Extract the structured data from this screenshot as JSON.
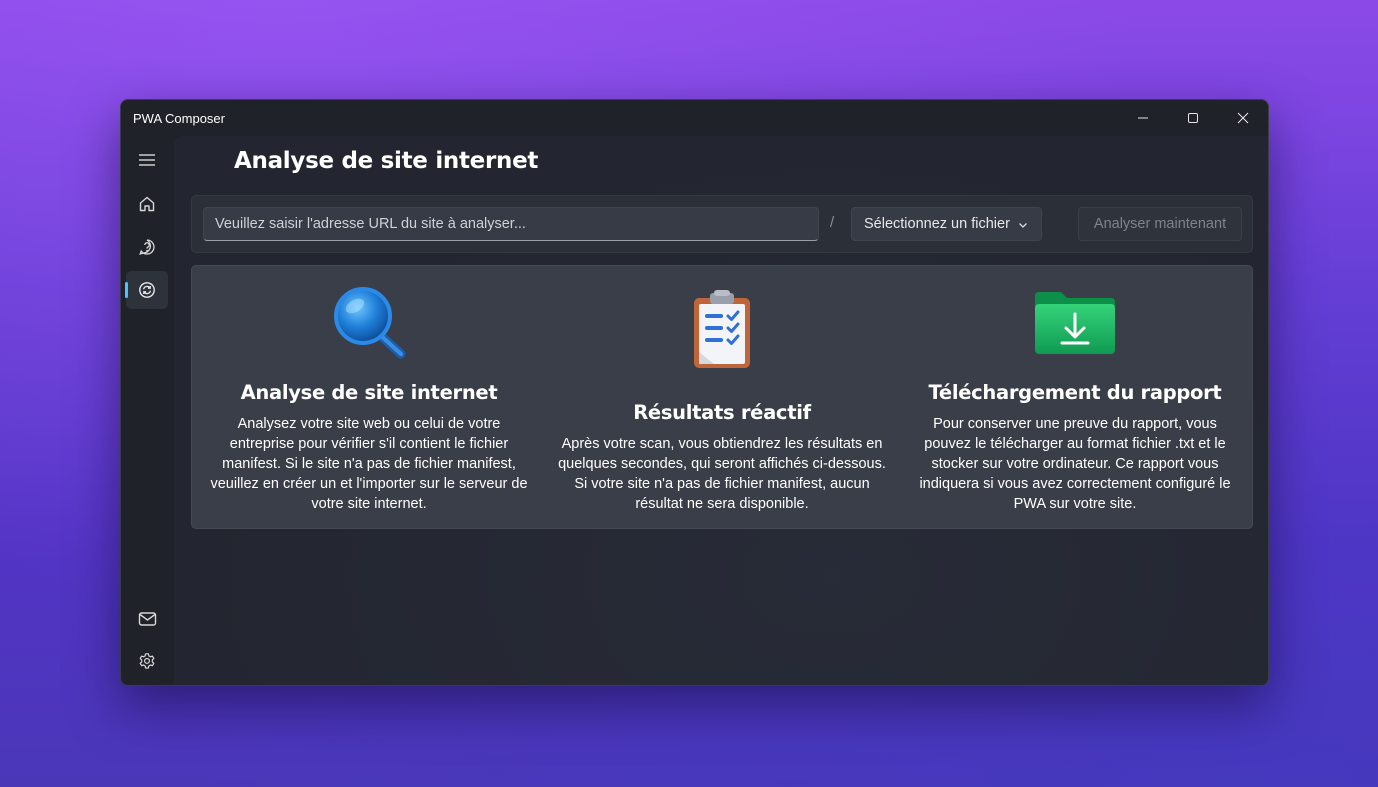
{
  "window": {
    "title": "PWA Composer"
  },
  "sidebar": {
    "items": [
      {
        "name": "menu",
        "icon": "hamburger-menu-icon"
      },
      {
        "name": "home",
        "icon": "home-icon"
      },
      {
        "name": "help",
        "icon": "help-icon"
      },
      {
        "name": "analyze",
        "icon": "sync-icon",
        "active": true
      },
      {
        "name": "mail",
        "icon": "mail-icon"
      },
      {
        "name": "settings",
        "icon": "gear-icon"
      }
    ]
  },
  "page": {
    "title": "Analyse de site internet"
  },
  "toolbar": {
    "url_placeholder": "Veuillez saisir l'adresse URL du site à analyser...",
    "separator": "/",
    "file_select_label": "Sélectionnez un fichier",
    "analyze_button": "Analyser maintenant"
  },
  "features": [
    {
      "icon": "magnifier-icon",
      "title": "Analyse de site internet",
      "description": "Analysez votre site web ou celui de votre entreprise pour vérifier s'il contient le fichier manifest. Si le site n'a pas de fichier manifest, veuillez en créer un et l'importer sur le serveur de votre site internet."
    },
    {
      "icon": "clipboard-checklist-icon",
      "title": "Résultats réactif",
      "description": "Après votre scan, vous obtiendrez les résultats en quelques secondes, qui seront affichés ci-dessous. Si votre site n'a pas de fichier manifest, aucun résultat ne sera disponible."
    },
    {
      "icon": "download-folder-icon",
      "title": "Téléchargement du rapport",
      "description": "Pour conserver une preuve du rapport, vous pouvez le télécharger au format fichier .txt et le stocker sur votre ordinateur. Ce rapport vous indiquera si vous avez correctement configuré le PWA sur votre site."
    }
  ],
  "colors": {
    "accent": "#4cc2ff",
    "window_bg": "#1f2229",
    "card_bg": "#3a3e48"
  }
}
